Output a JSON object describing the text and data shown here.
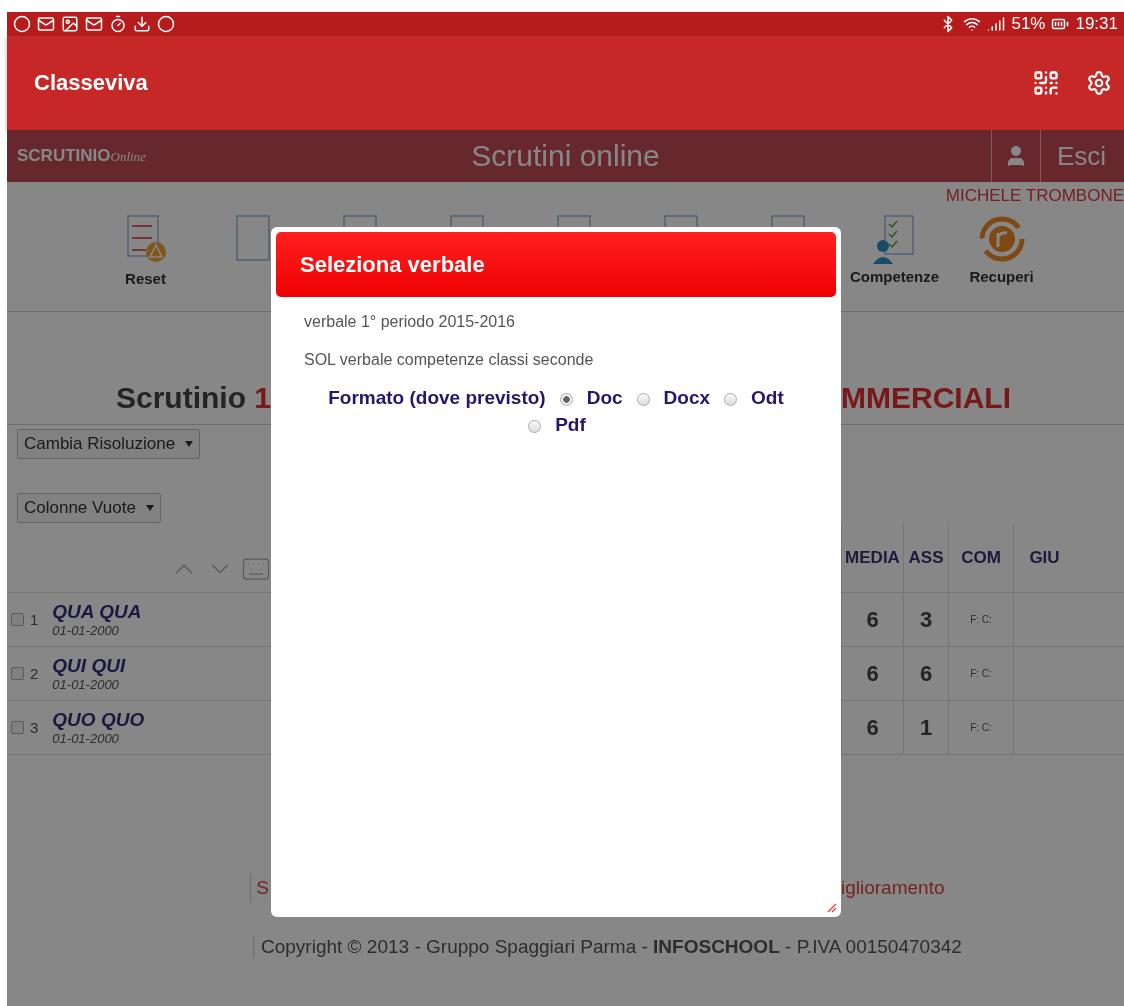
{
  "status_bar": {
    "battery": "51%",
    "time": "19:31"
  },
  "app_bar": {
    "title": "Classeviva"
  },
  "page": {
    "header": {
      "logo": "SCRUTINIO",
      "logo_sub": "Online",
      "title": "Scrutini online",
      "logout": "Esci"
    },
    "user_name": "MICHELE TROMBONE",
    "toolbar": [
      {
        "kind": "grades",
        "label": "Reset"
      },
      {
        "kind": "covered"
      },
      {
        "kind": "covered"
      },
      {
        "kind": "covered"
      },
      {
        "kind": "covered"
      },
      {
        "kind": "covered"
      },
      {
        "kind": "covered"
      },
      {
        "kind": "checklist",
        "label": "Competenze"
      },
      {
        "kind": "recovery",
        "label": "Recuperi"
      }
    ],
    "title": {
      "left": "Scrutinio",
      "number": "1",
      "right": "MMERCIALI"
    },
    "dropdowns": [
      "Cambia Risoluzione",
      "Colonne Vuote"
    ],
    "table": {
      "columns": [
        "MEDIA",
        "ASS",
        "COM",
        "GIU"
      ],
      "rows": [
        {
          "number": "1",
          "name": "QUA QUA",
          "date": "01-01-2000",
          "checked": false,
          "media": "6",
          "ass": "3",
          "com": "F: C:"
        },
        {
          "number": "2",
          "name": "QUI QUI",
          "date": "01-01-2000",
          "checked": false,
          "media": "6",
          "ass": "6",
          "com": "F: C:"
        },
        {
          "number": "3",
          "name": "QUO QUO",
          "date": "01-01-2000",
          "checked": false,
          "media": "6",
          "ass": "1",
          "com": "F: C:"
        }
      ]
    },
    "footer": {
      "link_left": "S",
      "link_right": "iglioramento",
      "copyright": "Copyright © 2013 - Gruppo Spaggiari Parma - **INFOSCHOOL** - P.IVA 00150470342"
    }
  },
  "dialog": {
    "title": "Seleziona verbale",
    "items": [
      "verbale 1° periodo 2015-2016",
      "SOL verbale competenze classi seconde"
    ],
    "format_label": "Formato (dove previsto)",
    "formats": [
      {
        "label": "Doc",
        "selected": true
      },
      {
        "label": "Docx",
        "selected": false
      },
      {
        "label": "Odt",
        "selected": false
      },
      {
        "label": "Pdf",
        "selected": false
      }
    ]
  }
}
